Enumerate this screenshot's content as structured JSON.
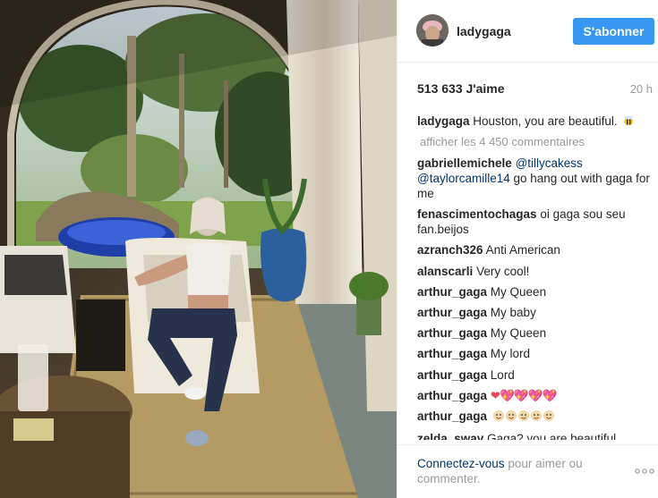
{
  "post": {
    "username": "ladygaga",
    "follow_label": "S'abonner",
    "likes": "513 633 J'aime",
    "time": "20 h",
    "caption": {
      "user": "ladygaga",
      "text": "Houston, you are beautiful.",
      "emoji": "bee"
    },
    "view_all": "afficher les 4 450 commentaires"
  },
  "comments": [
    {
      "user": "gabriellemichele",
      "mention1": "@tillycakess",
      "mention2": "@taylorcamille14",
      "text": "go hang out with gaga for me"
    },
    {
      "user": "fenascimentochagas",
      "text": "oi gaga sou seu fan.beijos"
    },
    {
      "user": "azranch326",
      "text": "Anti American"
    },
    {
      "user": "alanscarli",
      "text": "Very cool!"
    },
    {
      "user": "arthur_gaga",
      "text": "My Queen"
    },
    {
      "user": "arthur_gaga",
      "text": "My baby"
    },
    {
      "user": "arthur_gaga",
      "text": "My Queen"
    },
    {
      "user": "arthur_gaga",
      "text": "My lord"
    },
    {
      "user": "arthur_gaga",
      "text": "Lord"
    },
    {
      "user": "arthur_gaga",
      "hearts": "❤💖💖💖💖"
    },
    {
      "user": "arthur_gaga",
      "emoji": "sparkle-faces"
    },
    {
      "user": "zelda_sway",
      "text": "Gaga? you are beautiful"
    }
  ],
  "footer": {
    "login_link": "Connectez-vous",
    "login_rest": "pour aimer ou commenter.",
    "more_icon": "ellipsis-icon"
  },
  "colors": {
    "accent": "#3897f0",
    "link": "#003569",
    "muted": "#999999"
  }
}
